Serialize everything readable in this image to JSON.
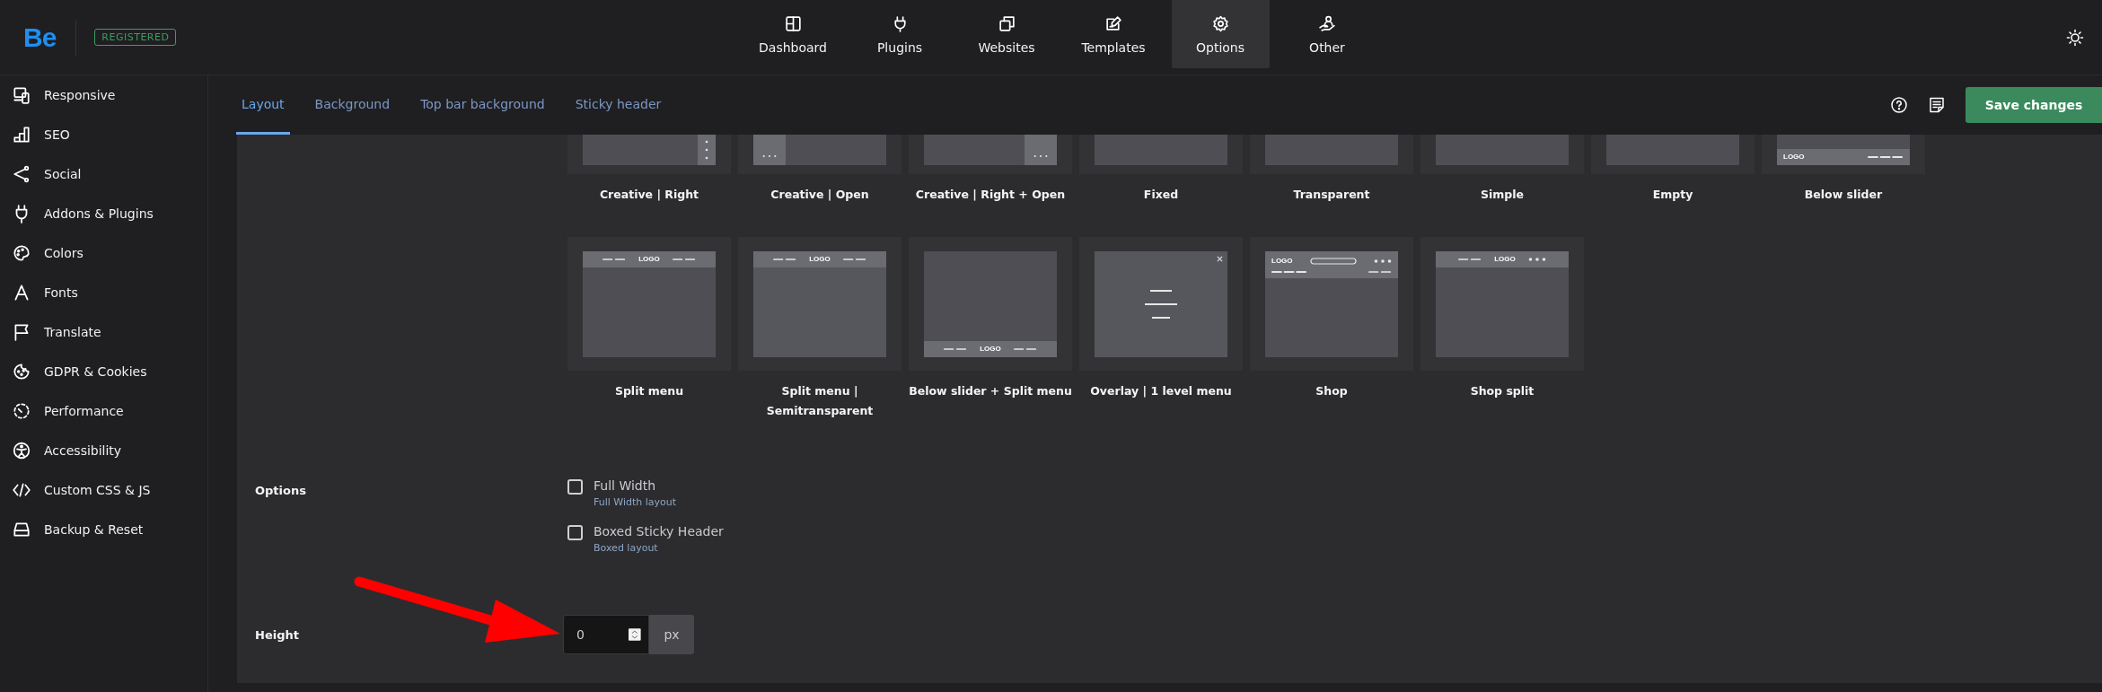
{
  "brand": {
    "logo": "Be",
    "badge": "REGISTERED"
  },
  "nav": [
    {
      "label": "Dashboard",
      "selected": false
    },
    {
      "label": "Plugins",
      "selected": false
    },
    {
      "label": "Websites",
      "selected": false
    },
    {
      "label": "Templates",
      "selected": false
    },
    {
      "label": "Options",
      "selected": true
    },
    {
      "label": "Other",
      "selected": false
    }
  ],
  "sidebar": {
    "items": [
      "Responsive",
      "SEO",
      "Social",
      "Addons & Plugins",
      "Colors",
      "Fonts",
      "Translate",
      "GDPR & Cookies",
      "Performance",
      "Accessibility",
      "Custom CSS & JS",
      "Backup & Reset"
    ]
  },
  "tabs": [
    {
      "label": "Layout",
      "selected": true
    },
    {
      "label": "Background",
      "selected": false
    },
    {
      "label": "Top bar background",
      "selected": false
    },
    {
      "label": "Sticky header",
      "selected": false
    }
  ],
  "save_button": "Save changes",
  "layouts": {
    "rows": [
      [
        {
          "label": "Creative | Right",
          "kind": "creative-right"
        },
        {
          "label": "Creative | Open",
          "kind": "creative-open"
        },
        {
          "label": "Creative | Right + Open",
          "kind": "creative-right-open"
        },
        {
          "label": "Fixed",
          "kind": "plain"
        },
        {
          "label": "Transparent",
          "kind": "plain"
        },
        {
          "label": "Simple",
          "kind": "plain"
        },
        {
          "label": "Empty",
          "kind": "plain"
        },
        {
          "label": "Below slider",
          "kind": "below-slider",
          "logo_text": "LOGO"
        }
      ],
      [
        {
          "label": "Split menu",
          "kind": "split-menu",
          "logo_text": "LOGO"
        },
        {
          "label": "Split menu | Semitransparent",
          "kind": "split-menu-semi",
          "logo_text": "LOGO"
        },
        {
          "label": "Below slider + Split menu",
          "kind": "below-slider-split",
          "logo_text": "LOGO"
        },
        {
          "label": "Overlay | 1 level menu",
          "kind": "overlay"
        },
        {
          "label": "Shop",
          "kind": "shop",
          "logo_text": "LOGO"
        },
        {
          "label": "Shop split",
          "kind": "shop-split",
          "logo_text": "LOGO"
        }
      ]
    ]
  },
  "options": {
    "label": "Options",
    "checkboxes": [
      {
        "label": "Full Width",
        "hint": "Full Width layout",
        "checked": false
      },
      {
        "label": "Boxed Sticky Header",
        "hint": "Boxed layout",
        "checked": false
      }
    ]
  },
  "height": {
    "label": "Height",
    "value": "0",
    "unit": "px"
  }
}
